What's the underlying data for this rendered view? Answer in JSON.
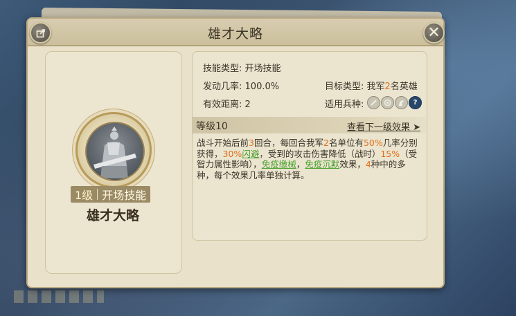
{
  "header": {
    "title": "雄才大略",
    "close_glyph": "✕"
  },
  "skill_card": {
    "level_label": "1级",
    "type_label": "开场技能",
    "name": "雄才大略"
  },
  "info": {
    "skill_type_label": "技能类型:",
    "skill_type_value": "开场技能",
    "trigger_rate_label": "发动几率:",
    "trigger_rate_value": "100.0%",
    "range_label": "有效距离:",
    "range_value": "2",
    "target_type_label": "目标类型:",
    "target_type_prefix": "我军",
    "target_type_count": "2",
    "target_type_suffix": "名英雄",
    "troops_label": "适用兵种:",
    "troop_icons": [
      "sword-icon",
      "target-icon",
      "horse-icon",
      "question-icon"
    ],
    "troop_help_glyph": "?"
  },
  "level_bar": {
    "level": "等级10",
    "next_link": "查看下一级效果 ➤"
  },
  "description": {
    "p1": "战斗开始后前",
    "n1": "3",
    "p2": "回合，每回合我军",
    "n2": "2",
    "p3": "名单位有",
    "n3": "50%",
    "p4": "几率分别获得，",
    "n4": "30%",
    "l1": "闪避",
    "p5": "，受到的攻击伤害降低（战时）",
    "n5": "15%",
    "p6": "（受智力属性影响），",
    "l2": "免疫缴械",
    "p7": "，",
    "l3": "免疫沉默",
    "p8": "效果，",
    "n6": "4",
    "p9": "种中的多种，每个效果几率单独计算。"
  },
  "colors": {
    "highlight_number": "#e0701b",
    "highlight_link": "#48a12f",
    "panel_bg": "#e9e1c9"
  }
}
